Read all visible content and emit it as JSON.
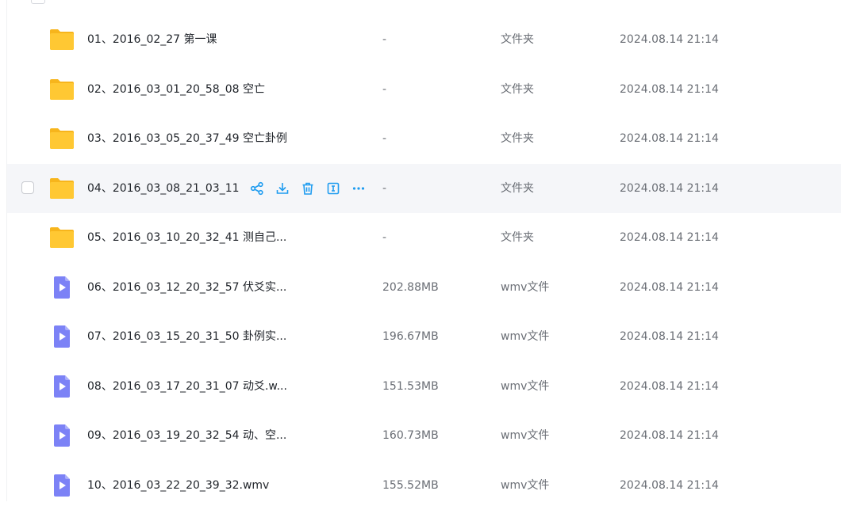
{
  "files": [
    {
      "name": "01、2016_02_27 第一课",
      "size": "-",
      "type": "文件夹",
      "modified": "2024.08.14 21:14",
      "icon": "folder-icon"
    },
    {
      "name": "02、2016_03_01_20_58_08 空亡",
      "size": "-",
      "type": "文件夹",
      "modified": "2024.08.14 21:14",
      "icon": "folder-icon"
    },
    {
      "name": "03、2016_03_05_20_37_49 空亡卦例",
      "size": "-",
      "type": "文件夹",
      "modified": "2024.08.14 21:14",
      "icon": "folder-icon"
    },
    {
      "name": "04、2016_03_08_21_03_11",
      "size": "-",
      "type": "文件夹",
      "modified": "2024.08.14 21:14",
      "icon": "folder-icon",
      "hovered": true
    },
    {
      "name": "05、2016_03_10_20_32_41 测自己...",
      "size": "-",
      "type": "文件夹",
      "modified": "2024.08.14 21:14",
      "icon": "folder-icon"
    },
    {
      "name": "06、2016_03_12_20_32_57 伏爻实...",
      "size": "202.88MB",
      "type": "wmv文件",
      "modified": "2024.08.14 21:14",
      "icon": "video-file-icon"
    },
    {
      "name": "07、2016_03_15_20_31_50 卦例实...",
      "size": "196.67MB",
      "type": "wmv文件",
      "modified": "2024.08.14 21:14",
      "icon": "video-file-icon"
    },
    {
      "name": "08、2016_03_17_20_31_07 动爻.w...",
      "size": "151.53MB",
      "type": "wmv文件",
      "modified": "2024.08.14 21:14",
      "icon": "video-file-icon"
    },
    {
      "name": "09、2016_03_19_20_32_54 动、空...",
      "size": "160.73MB",
      "type": "wmv文件",
      "modified": "2024.08.14 21:14",
      "icon": "video-file-icon"
    },
    {
      "name": "10、2016_03_22_20_39_32.wmv",
      "size": "155.52MB",
      "type": "wmv文件",
      "modified": "2024.08.14 21:14",
      "icon": "video-file-icon"
    }
  ],
  "row_actions": [
    {
      "icon": "share-icon"
    },
    {
      "icon": "download-icon"
    },
    {
      "icon": "delete-icon"
    },
    {
      "icon": "rename-icon"
    },
    {
      "icon": "more-icon"
    }
  ],
  "colors": {
    "folder": "#ffc833",
    "folder_back": "#f7b51c",
    "video": "#7c82f6",
    "action": "#1f9cf0",
    "hover_row": "#f5f6f9"
  }
}
